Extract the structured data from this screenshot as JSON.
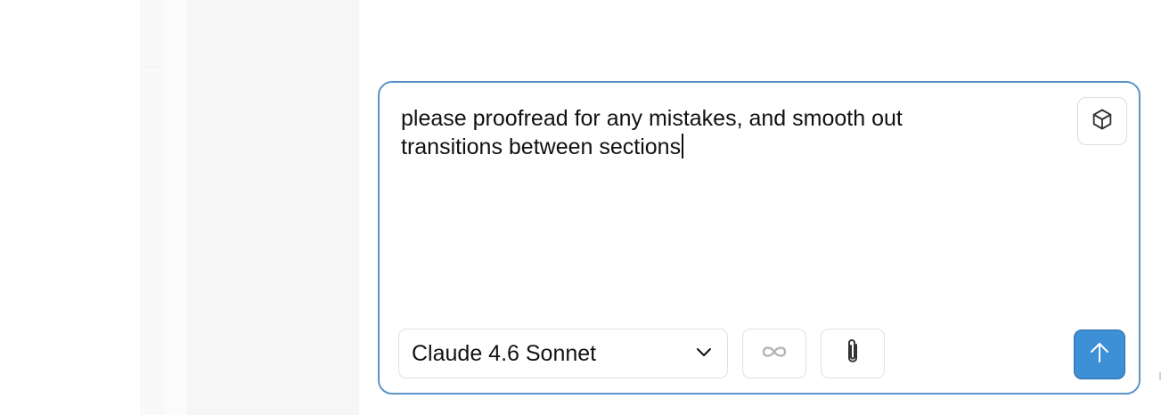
{
  "composer": {
    "prompt_text": "please proofread for any mistakes, and smooth out\ntransitions between sections",
    "model_select": {
      "selected": "Claude 4.6 Sonnet"
    },
    "icons": {
      "box": "box-icon",
      "chevron": "chevron-down-icon",
      "loop": "infinity-icon",
      "attach": "paperclip-icon",
      "send": "arrow-up-icon"
    },
    "colors": {
      "focus_border": "#5b95c9",
      "send_button": "#3d8fd6"
    }
  }
}
